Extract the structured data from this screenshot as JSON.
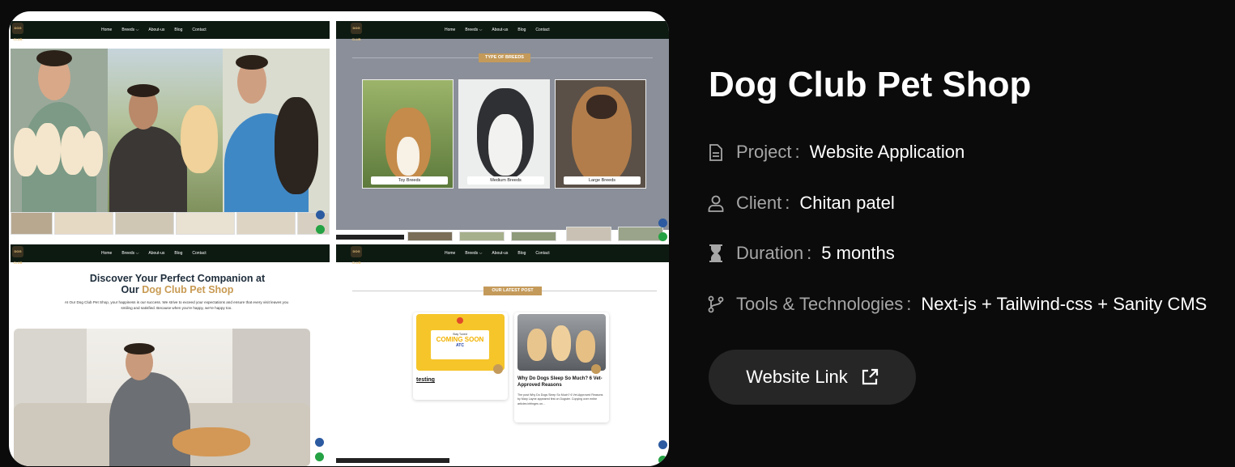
{
  "project_title": "Dog Club Pet Shop",
  "site_nav": {
    "logo_text": "DOG CLUB",
    "links": [
      "Home",
      "Breeds ⌵",
      "About-us",
      "Blog",
      "Contact"
    ]
  },
  "breeds_section": {
    "tag": "TYPE OF BREEDS",
    "cards": [
      "Toy Breeds",
      "Medium Breeds",
      "Large Breeds"
    ]
  },
  "hero_section": {
    "title_line1": "Discover Your Perfect Companion at",
    "title_line2_prefix": "Our ",
    "title_line2_accent": "Dog Club Pet Shop",
    "text": "At Our Dog Club Pet Shop, your happiness is our success. We strive to exceed your expectations and ensure that every visit leaves you smiling and satisfied. Because when you're happy, we're happy too."
  },
  "blog_section": {
    "tag": "OUR LATEST POST",
    "post1": {
      "title": "testing",
      "sign_small": "Stay Tuned",
      "sign_big": "COMING SOON",
      "sign_brand": "ATC"
    },
    "post2": {
      "title": "Why Do Dogs Sleep So Much? 6 Vet-Approved Reasons",
      "excerpt": "The post Why Do Dogs Sleep So Much? 6 Vet-Approved Reasons by Mary Layne appeared first on Dogster. Copying over entire articles infringes on..."
    }
  },
  "details": [
    {
      "icon": "document-icon",
      "label": "Project",
      "value": "Website Application"
    },
    {
      "icon": "user-icon",
      "label": "Client",
      "value": "Chitan patel"
    },
    {
      "icon": "hourglass-icon",
      "label": "Duration",
      "value": "5 months"
    },
    {
      "icon": "git-branch-icon",
      "label": "Tools & Technologies",
      "value": "Next-js + Tailwind-css + Sanity CMS"
    }
  ],
  "link_button": {
    "label": "Website Link",
    "icon": "external-link-icon"
  },
  "colors": {
    "background": "#0b0b0b",
    "button": "#262626",
    "accent_gold": "#c49a5a",
    "nav_dark": "#0d1a12",
    "label_gray": "#a6a6a6"
  }
}
